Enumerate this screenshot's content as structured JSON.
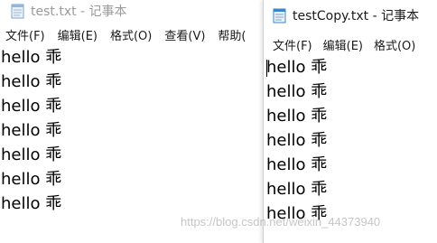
{
  "window1": {
    "title": "test.txt - 记事本",
    "menu": [
      "文件(F)",
      "编辑(E)",
      "格式(O)",
      "查看(V)",
      "帮助("
    ],
    "lines": [
      "hello 乖",
      "hello 乖",
      "hello 乖",
      "hello 乖",
      "hello 乖",
      "hello 乖",
      "hello 乖"
    ]
  },
  "window2": {
    "title": "testCopy.txt - 记事本",
    "menu": [
      "文件(F)",
      "编辑(E)",
      "格式(O)"
    ],
    "lines": [
      "hello 乖",
      "hello 乖",
      "hello 乖",
      "hello 乖",
      "hello 乖",
      "hello 乖",
      "hello 乖"
    ]
  },
  "watermark": "https://blog.csdn.net/weixin_44373940",
  "colors": {
    "inactive_title": "#9a9a9a",
    "active_title": "#1a1a1a",
    "icon_blue": "#3a86c8"
  }
}
